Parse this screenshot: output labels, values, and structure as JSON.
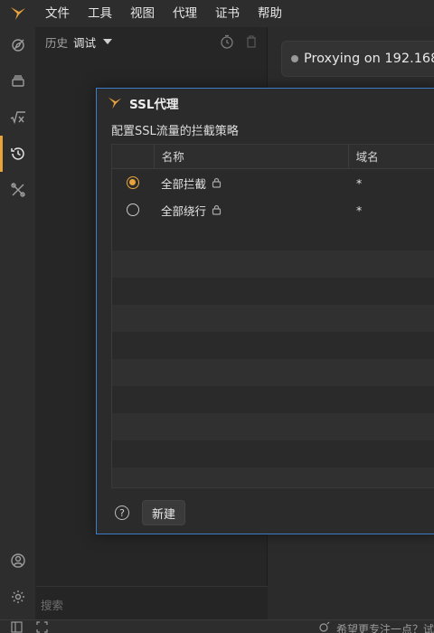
{
  "menubar": {
    "items": [
      "文件",
      "工具",
      "视图",
      "代理",
      "证书",
      "帮助"
    ]
  },
  "rail": {
    "icons": [
      "compass-icon",
      "layers-icon",
      "sqrt-x-icon",
      "history-icon",
      "tools-icon"
    ],
    "bottom_icons": [
      "account-icon",
      "settings-icon"
    ],
    "active": "history-icon"
  },
  "history_panel": {
    "label": "历史",
    "selected": "调试",
    "search_placeholder": "搜索"
  },
  "main": {
    "proxy_status": "Proxying on 192.168."
  },
  "statusbar": {
    "right_text": "希望更专注一点？试"
  },
  "dialog": {
    "title": "SSL代理",
    "subtitle": "配置SSL流量的拦截策略",
    "columns": [
      "",
      "名称",
      "域名"
    ],
    "rows": [
      {
        "selected": true,
        "name": "全部拦截",
        "locked": true,
        "domain": "*"
      },
      {
        "selected": false,
        "name": "全部绕行",
        "locked": true,
        "domain": "*"
      }
    ],
    "help_label": "?",
    "new_button": "新建"
  },
  "colors": {
    "accent": "#e8a33d",
    "dialog_border": "#3d7dc8",
    "background": "#2b2b2b"
  }
}
